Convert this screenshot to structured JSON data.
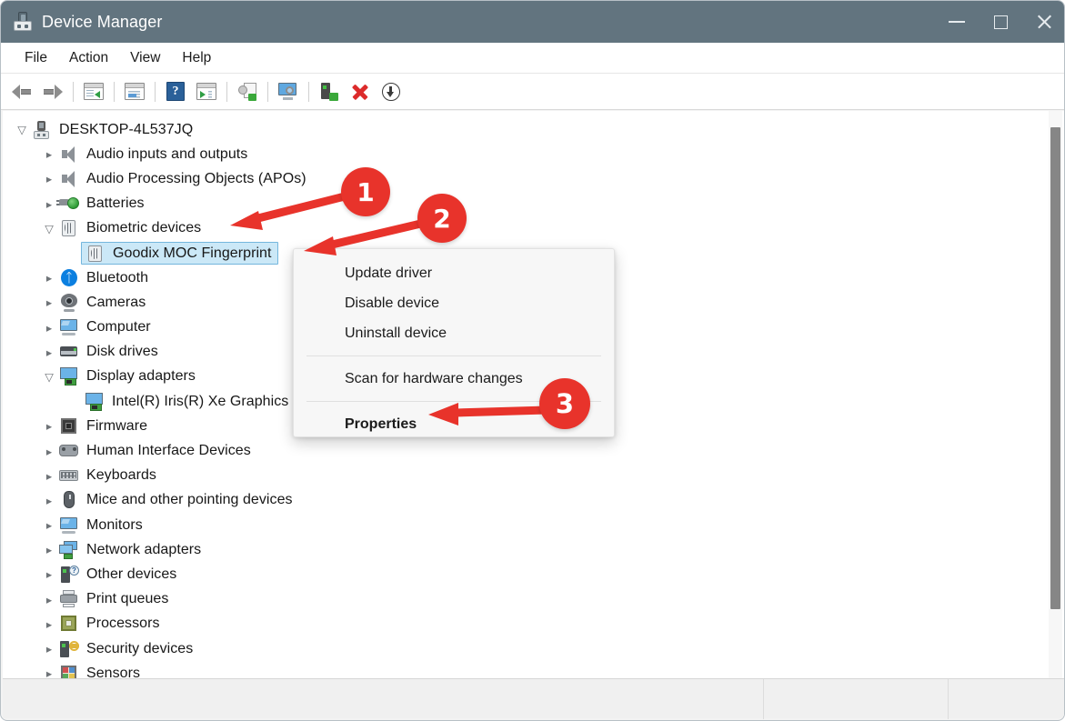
{
  "window": {
    "title": "Device Manager",
    "app_icon": "device-manager-icon",
    "controls": {
      "minimize": "—",
      "maximize": "□",
      "close": "✕"
    },
    "titlebar_color": "#62747f"
  },
  "menubar": {
    "items": [
      "File",
      "Action",
      "View",
      "Help"
    ]
  },
  "toolbar": {
    "buttons": [
      {
        "name": "back-button",
        "icon": "back-arrow-icon"
      },
      {
        "name": "forward-button",
        "icon": "forward-arrow-icon"
      },
      {
        "name": "show-hide-console-tree-button",
        "icon": "console-tree-icon"
      },
      {
        "name": "properties-button",
        "icon": "properties-window-icon"
      },
      {
        "name": "help-button",
        "icon": "help-question-icon"
      },
      {
        "name": "action-button",
        "icon": "action-window-icon"
      },
      {
        "name": "update-driver-button",
        "icon": "update-driver-icon"
      },
      {
        "name": "scan-for-hardware-changes-button",
        "icon": "scan-monitor-icon"
      },
      {
        "name": "enable-device-button",
        "icon": "enable-device-icon"
      },
      {
        "name": "uninstall-device-button",
        "icon": "red-x-icon"
      },
      {
        "name": "disable-device-button",
        "icon": "down-arrow-circle-icon"
      }
    ]
  },
  "tree": {
    "root": {
      "label": "DESKTOP-4L537JQ",
      "icon": "computer-root-icon",
      "expanded": true
    },
    "items": [
      {
        "label": "Audio inputs and outputs",
        "icon": "speaker-icon",
        "indent": 1,
        "state": "collapsed"
      },
      {
        "label": "Audio Processing Objects (APOs)",
        "icon": "speaker-icon",
        "indent": 1,
        "state": "collapsed"
      },
      {
        "label": "Batteries",
        "icon": "battery-plug-icon",
        "indent": 1,
        "state": "collapsed"
      },
      {
        "label": "Biometric devices",
        "icon": "fingerprint-icon",
        "indent": 1,
        "state": "expanded"
      },
      {
        "label": "Goodix MOC Fingerprint",
        "icon": "fingerprint-icon",
        "indent": 2,
        "state": "leaf",
        "selected": true
      },
      {
        "label": "Bluetooth",
        "icon": "bluetooth-icon",
        "indent": 1,
        "state": "collapsed"
      },
      {
        "label": "Cameras",
        "icon": "camera-icon",
        "indent": 1,
        "state": "collapsed"
      },
      {
        "label": "Computer",
        "icon": "monitor-icon",
        "indent": 1,
        "state": "collapsed"
      },
      {
        "label": "Disk drives",
        "icon": "disk-drive-icon",
        "indent": 1,
        "state": "collapsed"
      },
      {
        "label": "Display adapters",
        "icon": "display-adapter-icon",
        "indent": 1,
        "state": "expanded"
      },
      {
        "label": "Intel(R) Iris(R) Xe Graphics",
        "icon": "display-adapter-icon",
        "indent": 2,
        "state": "leaf"
      },
      {
        "label": "Firmware",
        "icon": "firmware-chip-icon",
        "indent": 1,
        "state": "collapsed"
      },
      {
        "label": "Human Interface Devices",
        "icon": "hid-gamepad-icon",
        "indent": 1,
        "state": "collapsed"
      },
      {
        "label": "Keyboards",
        "icon": "keyboard-icon",
        "indent": 1,
        "state": "collapsed"
      },
      {
        "label": "Mice and other pointing devices",
        "icon": "mouse-icon",
        "indent": 1,
        "state": "collapsed"
      },
      {
        "label": "Monitors",
        "icon": "monitor-icon",
        "indent": 1,
        "state": "collapsed"
      },
      {
        "label": "Network adapters",
        "icon": "network-adapter-icon",
        "indent": 1,
        "state": "collapsed"
      },
      {
        "label": "Other devices",
        "icon": "other-devices-question-icon",
        "indent": 1,
        "state": "collapsed"
      },
      {
        "label": "Print queues",
        "icon": "printer-icon",
        "indent": 1,
        "state": "collapsed"
      },
      {
        "label": "Processors",
        "icon": "processor-chip-icon",
        "indent": 1,
        "state": "collapsed"
      },
      {
        "label": "Security devices",
        "icon": "security-key-icon",
        "indent": 1,
        "state": "collapsed"
      },
      {
        "label": "Sensors",
        "icon": "sensors-icon",
        "indent": 1,
        "state": "collapsed"
      }
    ]
  },
  "context_menu": {
    "items": [
      {
        "label": "Update driver",
        "bold": false
      },
      {
        "label": "Disable device",
        "bold": false
      },
      {
        "label": "Uninstall device",
        "bold": false
      },
      {
        "separator": true
      },
      {
        "label": "Scan for hardware changes",
        "bold": false
      },
      {
        "separator": true
      },
      {
        "label": "Properties",
        "bold": true
      }
    ]
  },
  "annotations": {
    "accent_color": "#e8332b",
    "badges": [
      {
        "number": "1",
        "target": "Biometric devices"
      },
      {
        "number": "2",
        "target": "Goodix MOC Fingerprint"
      },
      {
        "number": "3",
        "target": "Properties"
      }
    ]
  },
  "statusbar": {
    "cells": [
      "",
      "",
      ""
    ]
  },
  "scrollbar": {
    "orientation": "vertical",
    "thumb_color": "#868686"
  }
}
